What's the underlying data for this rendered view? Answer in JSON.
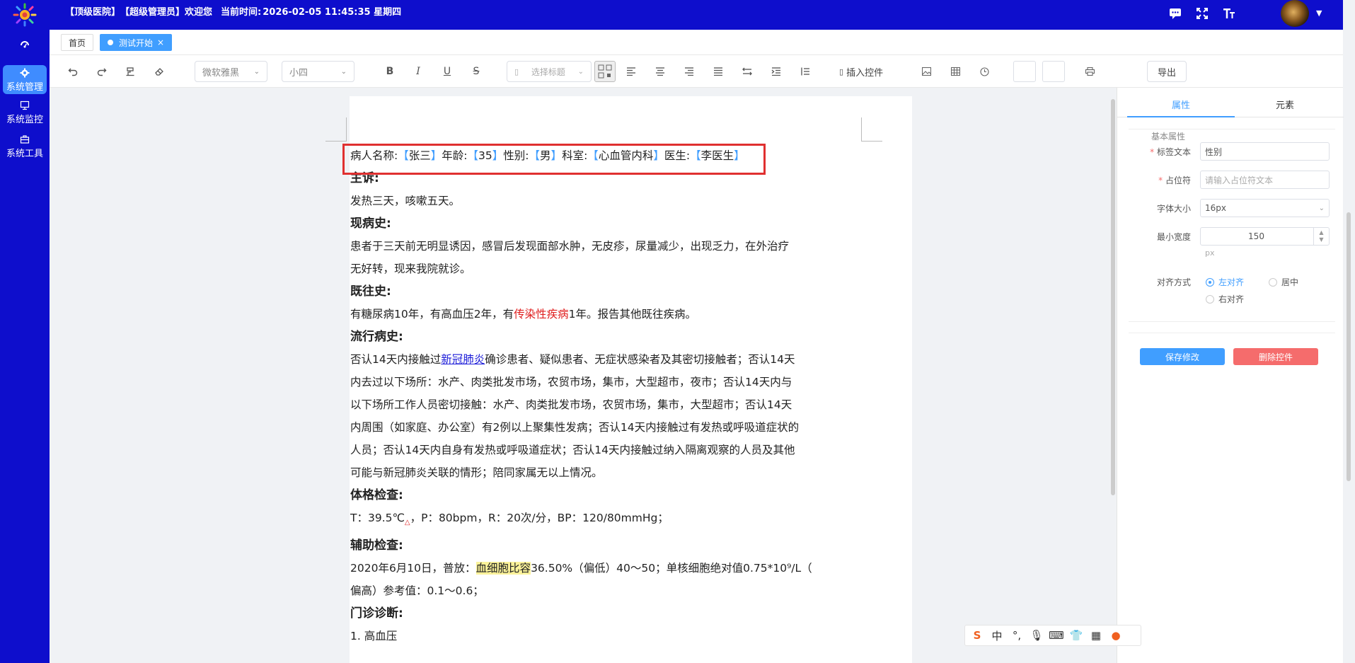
{
  "header": {
    "hospital": "【顶级医院】",
    "role": "【超级管理员】欢迎您",
    "time_label": "当前时间:",
    "time_value": "2026-02-05 11:45:35 星期四"
  },
  "sidebar": {
    "items": [
      {
        "label": "系统管理",
        "icon": "gear-icon"
      },
      {
        "label": "系统监控",
        "icon": "monitor-icon"
      },
      {
        "label": "系统工具",
        "icon": "toolbox-icon"
      }
    ]
  },
  "tabs": {
    "home": "首页",
    "active": "测试开始"
  },
  "toolbar": {
    "font_family": "微软雅黑",
    "font_size": "小四",
    "heading_placeholder": "选择标题",
    "insert_control": "插入控件",
    "export": "导出"
  },
  "document": {
    "patient_line": {
      "name_label": "病人名称:",
      "name": "张三",
      "age_label": "年龄:",
      "age": "35",
      "gender_label": "性别:",
      "gender": "男",
      "dept_label": "科室:",
      "dept": "心血管内科",
      "doctor_label": "医生:",
      "doctor": "李医生"
    },
    "chief_complaint_h": "主诉:",
    "chief_complaint": "发热三天，咳嗽五天。",
    "present_h": "现病史:",
    "present_1": "患者于三天前无明显诱因，感冒后发现面部水肿，无皮疹，尿量减少，出现乏力，在外治疗",
    "present_2": "无好转，现来我院就诊。",
    "past_h": "既往史:",
    "past_a": "有糖尿病10年，有高血压2年，有",
    "past_red": "传染性疾病",
    "past_b": "1年。报告其他既往疾病。",
    "epi_h": "流行病史:",
    "epi_1a": "否认14天内接触过",
    "epi_link": "新冠肺炎",
    "epi_1b": "确诊患者、疑似患者、无症状感染者及其密切接触者；否认14天",
    "epi_2": "内去过以下场所：水产、肉类批发市场，农贸市场，集市，大型超市，夜市；否认14天内与",
    "epi_3": "以下场所工作人员密切接触：水产、肉类批发市场，农贸市场，集市，大型超市；否认14天",
    "epi_4": "内周围（如家庭、办公室）有2例以上聚集性发病；否认14天内接触过有发热或呼吸道症状的",
    "epi_5": "人员；否认14天内自身有发热或呼吸道症状；否认14天内接触过纳入隔离观察的人员及其他",
    "epi_6": "可能与新冠肺炎关联的情形；陪同家属无以上情况。",
    "exam_h": "体格检查:",
    "exam_a": "T：39.5℃",
    "exam_mark": "△",
    "exam_b": "，P：80bpm，R：20次/分，BP：120/80mmHg；",
    "aux_h": "辅助检查:",
    "aux_1a": "2020年6月10日，普放：",
    "aux_hl": "血细胞比容",
    "aux_1b": "36.50%（偏低）40～50；单核细胞绝对值0.75*10⁹/L（",
    "aux_2": "偏高）参考值：0.1～0.6；",
    "diag_h": "门诊诊断:",
    "diag_1": "1. 高血压"
  },
  "panel": {
    "tab_props": "属性",
    "tab_elements": "元素",
    "legend": "基本属性",
    "label_text_label": "标签文本",
    "label_text_value": "性别",
    "placeholder_label": "占位符",
    "placeholder_hint": "请输入占位符文本",
    "font_size_label": "字体大小",
    "font_size_value": "16px",
    "min_width_label": "最小宽度",
    "min_width_value": "150",
    "unit": "px",
    "align_label": "对齐方式",
    "align_left": "左对齐",
    "align_center": "居中",
    "align_right": "右对齐",
    "save": "保存修改",
    "delete": "删除控件"
  },
  "ime": {
    "lang": "中"
  },
  "colors": {
    "brand": "#0e0ecc",
    "accent": "#409eff",
    "danger": "#f56c6c",
    "highlight_box": "#e03030"
  }
}
